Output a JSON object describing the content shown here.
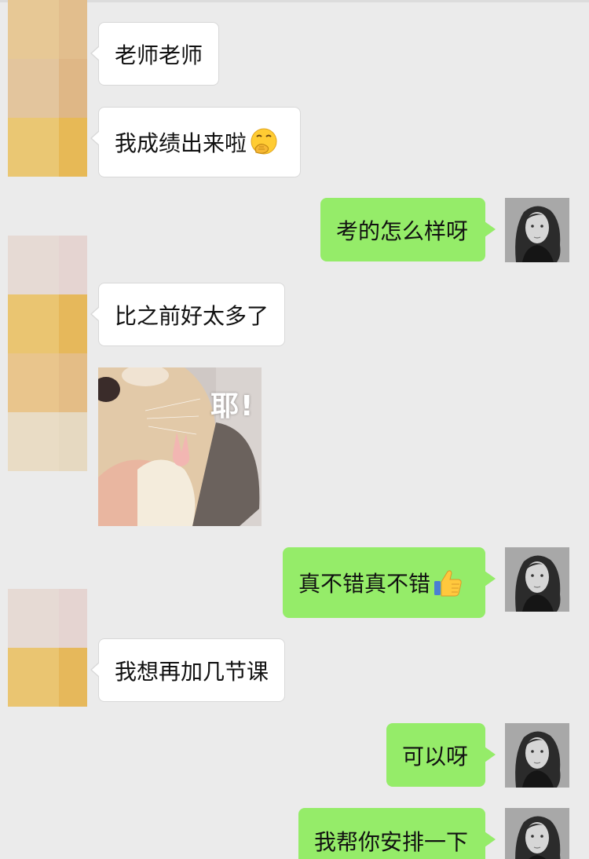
{
  "messages": [
    {
      "side": "left",
      "text": "老师老师"
    },
    {
      "side": "left",
      "text": "我成绩出来啦",
      "emoji": "hand-over-mouth-face-icon"
    },
    {
      "side": "right",
      "text": "考的怎么样呀"
    },
    {
      "side": "left",
      "text": "比之前好太多了"
    },
    {
      "side": "left",
      "type": "sticker",
      "caption": "耶!",
      "image": "hamster-victory-sticker"
    },
    {
      "side": "right",
      "text": "真不错真不错",
      "emoji": "thumbs-up-icon"
    },
    {
      "side": "left",
      "text": "我想再加几节课"
    },
    {
      "side": "right",
      "text": "可以呀"
    },
    {
      "side": "right",
      "text": "我帮你安排一下"
    }
  ],
  "colors": {
    "background": "#ebebeb",
    "right_bubble": "#95ec69",
    "left_bubble": "#ffffff",
    "mosaic_gold": "#e8c06a",
    "mosaic_beige": "#e6d2bd",
    "mosaic_pink": "#e6dad6"
  }
}
